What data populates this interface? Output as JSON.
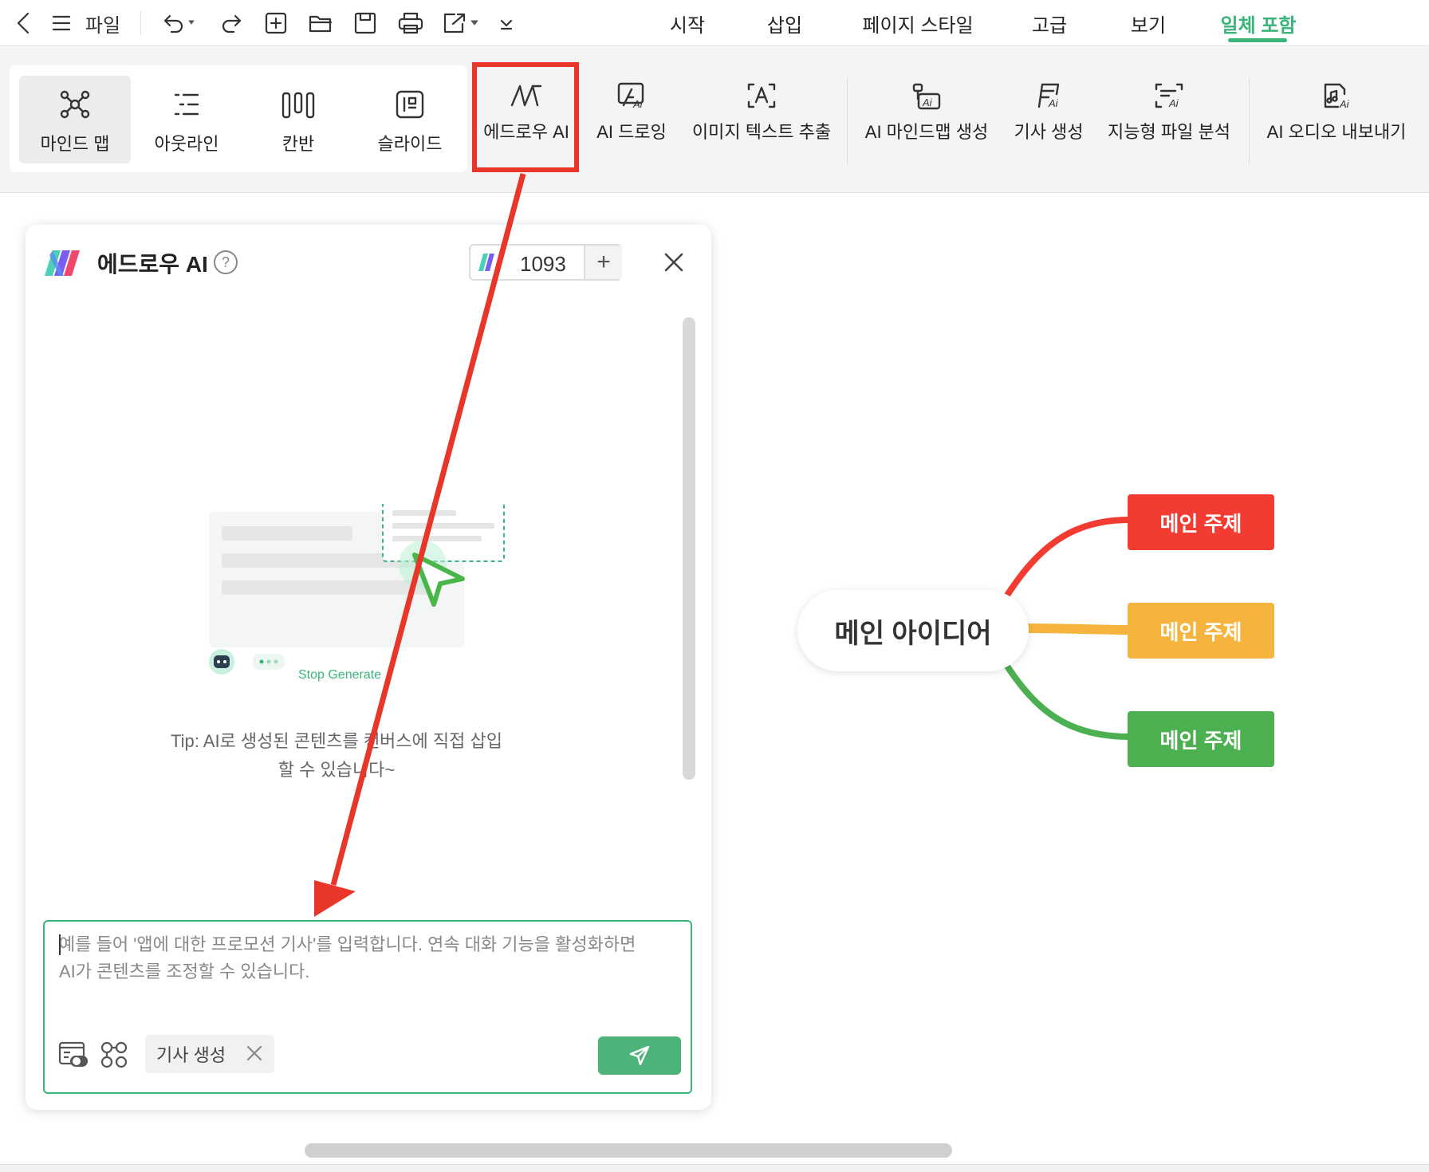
{
  "menubar": {
    "file_label": "파일",
    "tabs": [
      {
        "label": "시작",
        "active": false
      },
      {
        "label": "삽입",
        "active": false
      },
      {
        "label": "페이지 스타일",
        "active": false
      },
      {
        "label": "고급",
        "active": false
      },
      {
        "label": "보기",
        "active": false
      },
      {
        "label": "일체 포함",
        "active": true
      }
    ],
    "accent_color": "#3bb47a"
  },
  "ribbon": {
    "view_modes": [
      {
        "label": "마인드 맵",
        "icon": "mindmap-icon",
        "selected": true
      },
      {
        "label": "아웃라인",
        "icon": "outline-icon",
        "selected": false
      },
      {
        "label": "칸반",
        "icon": "kanban-icon",
        "selected": false
      },
      {
        "label": "슬라이드",
        "icon": "slide-icon",
        "selected": false
      }
    ],
    "ai_tools": [
      {
        "label": "에드로우 AI",
        "icon": "edraw-ai-icon",
        "highlighted": true
      },
      {
        "label": "AI 드로잉",
        "icon": "ai-drawing-icon"
      },
      {
        "label": "이미지 텍스트 추출",
        "icon": "ocr-icon"
      },
      {
        "label": "AI 마인드맵 생성",
        "icon": "ai-mindmap-icon"
      },
      {
        "label": "기사 생성",
        "icon": "article-icon"
      },
      {
        "label": "지능형 파일 분석",
        "icon": "file-analysis-icon"
      },
      {
        "label": "AI 오디오 내보내기",
        "icon": "audio-export-icon"
      }
    ]
  },
  "ai_panel": {
    "title": "에드로우 AI",
    "help": "?",
    "credits": "1093",
    "stop_generate": "Stop Generate",
    "tip": "Tip: AI로 생성된 콘텐츠를 캔버스에 직접 삽입\n할 수 있습니다~",
    "input_placeholder": "예를 들어 '앱에 대한 프로모션 기사'를 입력합니다. 연속 대화 기능을 활성화하면\nAI가 콘텐츠를 조정할 수 있습니다.",
    "tag": "기사 생성"
  },
  "mindmap": {
    "central": "메인 아이디어",
    "topics": [
      {
        "label": "메인 주제",
        "color": "#f23c31"
      },
      {
        "label": "메인 주제",
        "color": "#f5b43d"
      },
      {
        "label": "메인 주제",
        "color": "#4caf50"
      }
    ]
  },
  "annotation": {
    "color": "#e8372a"
  }
}
